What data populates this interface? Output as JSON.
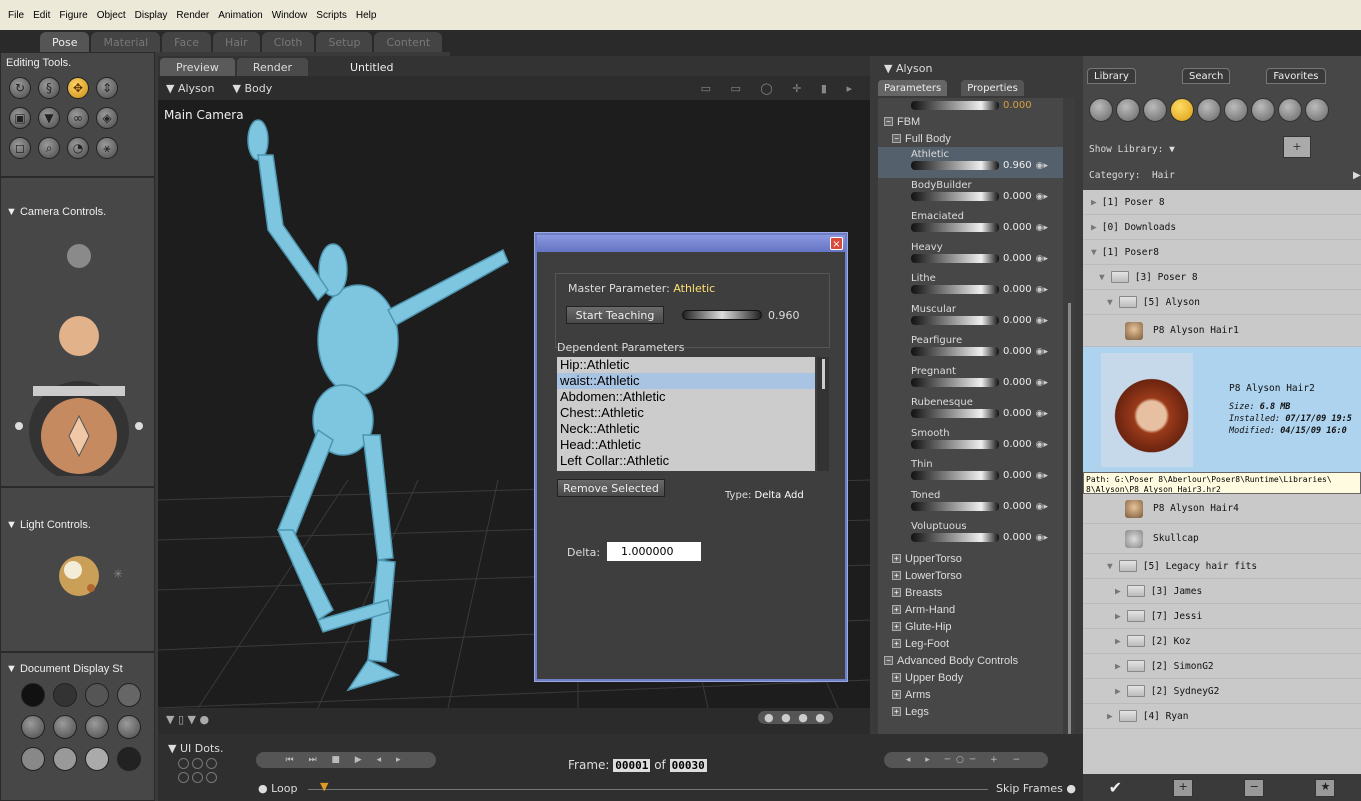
{
  "menu": [
    "File",
    "Edit",
    "Figure",
    "Object",
    "Display",
    "Render",
    "Animation",
    "Window",
    "Scripts",
    "Help"
  ],
  "rooms": [
    "Pose",
    "Material",
    "Face",
    "Hair",
    "Cloth",
    "Setup",
    "Content"
  ],
  "editing_tools": {
    "title": "Editing Tools."
  },
  "camera_controls": {
    "title": "Camera Controls."
  },
  "light_controls": {
    "title": "Light Controls."
  },
  "document_display": {
    "title": "Document Display St"
  },
  "ui_dots": {
    "title": "UI Dots."
  },
  "viewport": {
    "tabs": [
      "Preview",
      "Render"
    ],
    "doc_title": "Untitled",
    "figure_select": "Alyson",
    "actor_select": "Body",
    "camera_label": "Main Camera"
  },
  "dialog": {
    "master_label": "Master Parameter:",
    "master_value": "Athletic",
    "start_teaching": "Start Teaching",
    "master_dial_value": "0.960",
    "dependent_label": "Dependent Parameters",
    "dependents": [
      "Hip::Athletic",
      "waist::Athletic",
      "Abdomen::Athletic",
      "Chest::Athletic",
      "Neck::Athletic",
      "Head::Athletic",
      "Left Collar::Athletic"
    ],
    "selected_index": 1,
    "remove_selected": "Remove Selected",
    "type_label": "Type:",
    "type_value": "Delta Add",
    "delta_label": "Delta:",
    "delta_value": "1.000000",
    "close": "×"
  },
  "params_panel": {
    "figure": "Alyson",
    "tabs": [
      "Parameters",
      "Properties"
    ],
    "top_value": "0.000",
    "fbm_group": "FBM",
    "fullbody_group": "Full Body",
    "items": [
      {
        "name": "Athletic",
        "value": "0.960"
      },
      {
        "name": "BodyBuilder",
        "value": "0.000"
      },
      {
        "name": "Emaciated",
        "value": "0.000"
      },
      {
        "name": "Heavy",
        "value": "0.000"
      },
      {
        "name": "Lithe",
        "value": "0.000"
      },
      {
        "name": "Muscular",
        "value": "0.000"
      },
      {
        "name": "Pearfigure",
        "value": "0.000"
      },
      {
        "name": "Pregnant",
        "value": "0.000"
      },
      {
        "name": "Rubenesque",
        "value": "0.000"
      },
      {
        "name": "Smooth",
        "value": "0.000"
      },
      {
        "name": "Thin",
        "value": "0.000"
      },
      {
        "name": "Toned",
        "value": "0.000"
      },
      {
        "name": "Voluptuous",
        "value": "0.000"
      }
    ],
    "groups": [
      "UpperTorso",
      "LowerTorso",
      "Breasts",
      "Arm-Hand",
      "Glute-Hip",
      "Leg-Foot"
    ],
    "advanced_group": "Advanced Body Controls",
    "advanced_items": [
      "Upper Body",
      "Arms",
      "Legs"
    ]
  },
  "library": {
    "tabs": [
      "Library",
      "Search",
      "Favorites"
    ],
    "show_library": "Show Library:",
    "category_label": "Category:",
    "category_value": "Hair",
    "rows": [
      {
        "indent": 0,
        "arrow": "▶",
        "text": "[1]  Poser 8",
        "folder": false
      },
      {
        "indent": 0,
        "arrow": "▶",
        "text": "[0]  Downloads",
        "folder": false
      },
      {
        "indent": 0,
        "arrow": "▼",
        "text": "[1]  Poser8",
        "folder": false
      },
      {
        "indent": 1,
        "arrow": "▼",
        "text": "[3]  Poser 8",
        "folder": true
      },
      {
        "indent": 2,
        "arrow": "▼",
        "text": "[5]  Alyson",
        "folder": true
      }
    ],
    "hair1": "P8 Alyson Hair1",
    "selected_item": {
      "name": "P8 Alyson Hair2",
      "size_label": "Size:",
      "size": "6.8 MB",
      "installed_label": "Installed:",
      "installed": "07/17/09 19:5",
      "modified_label": "Modified:",
      "modified": "04/15/09 16:0"
    },
    "tooltip": "Path: G:\\Poser 8\\Aberlour\\Poser8\\Runtime\\Libraries\\ 8\\Alyson\\P8 Alyson Hair3.hr2",
    "hair4": "P8 Alyson Hair4",
    "skullcap": "Skullcap",
    "legacy": "[5]  Legacy hair fits",
    "legacy_children": [
      "[3]  James",
      "[7]  Jessi",
      "[2]  Koz",
      "[2]  SimonG2",
      "[2]  SydneyG2"
    ],
    "ryan": "[4]  Ryan"
  },
  "timeline": {
    "frame_label": "Frame:",
    "frame_current": "00001",
    "of_label": "of",
    "frame_total": "00030",
    "loop": "Loop",
    "skip_frames": "Skip Frames"
  }
}
